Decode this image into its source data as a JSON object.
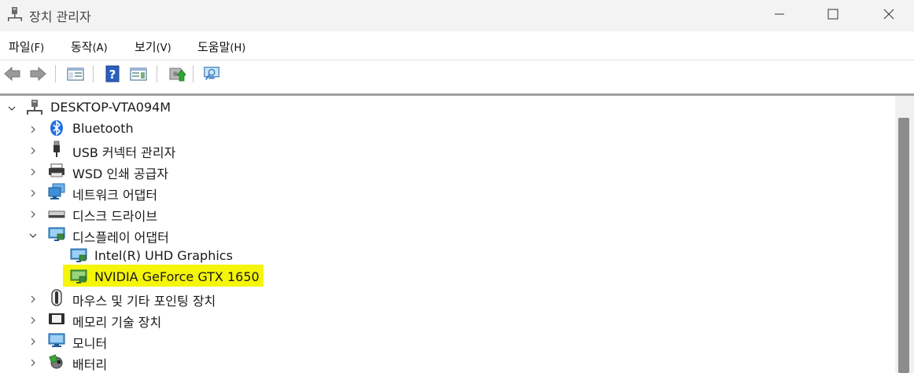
{
  "window": {
    "title": "장치 관리자"
  },
  "menu": [
    {
      "label": "파일",
      "accel": "(F)"
    },
    {
      "label": "동작",
      "accel": "(A)"
    },
    {
      "label": "보기",
      "accel": "(V)"
    },
    {
      "label": "도움말",
      "accel": "(H)"
    }
  ],
  "toolbar": {
    "icons": [
      "back-arrow-icon",
      "forward-arrow-icon",
      "show-hide-console-tree-icon",
      "help-icon",
      "properties-icon",
      "update-driver-icon",
      "scan-hardware-icon"
    ]
  },
  "tree": {
    "root": "DESKTOP-VTA094M",
    "items": [
      {
        "label": "Bluetooth",
        "icon": "bluetooth-icon",
        "expanded": false
      },
      {
        "label": "USB 커넥터 관리자",
        "icon": "usb-icon",
        "expanded": false
      },
      {
        "label": "WSD 인쇄 공급자",
        "icon": "printer-icon",
        "expanded": false
      },
      {
        "label": "네트워크 어댑터",
        "icon": "network-adapter-icon",
        "expanded": false
      },
      {
        "label": "디스크 드라이브",
        "icon": "disk-drive-icon",
        "expanded": false
      },
      {
        "label": "디스플레이 어댑터",
        "icon": "display-adapter-icon",
        "expanded": true
      },
      {
        "label": "마우스 및 기타 포인팅 장치",
        "icon": "mouse-icon",
        "expanded": false
      },
      {
        "label": "메모리 기술 장치",
        "icon": "memory-device-icon",
        "expanded": false
      },
      {
        "label": "모니터",
        "icon": "monitor-icon",
        "expanded": false
      },
      {
        "label": "배터리",
        "icon": "battery-icon",
        "expanded": false
      }
    ],
    "display_children": [
      {
        "label": "Intel(R) UHD Graphics",
        "icon": "display-adapter-icon"
      },
      {
        "label": "NVIDIA GeForce GTX 1650",
        "icon": "display-adapter-icon",
        "highlighted": true
      }
    ]
  },
  "colors": {
    "highlight": "#f5f50a",
    "titlebar_bg": "#f3f3f3",
    "scroll_thumb": "#8c8c8c"
  }
}
